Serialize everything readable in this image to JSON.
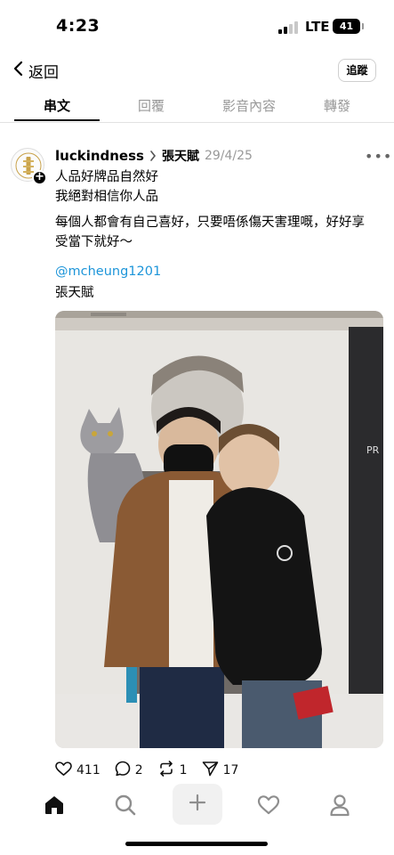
{
  "status_bar": {
    "time": "4:23",
    "network": "LTE",
    "battery": "41"
  },
  "header": {
    "back_label": "返回",
    "follow_label": "追蹤"
  },
  "tabs": [
    {
      "label": "串文",
      "active": true
    },
    {
      "label": "回覆",
      "active": false
    },
    {
      "label": "影音內容",
      "active": false
    },
    {
      "label": "轉發",
      "active": false
    }
  ],
  "post": {
    "author": "luckindness",
    "reply_to": "張天賦",
    "date": "29/4/25",
    "lines": [
      "人品好牌品自然好",
      "我絕對相信你人品",
      "每個人都會有自己喜好，只要唔係傷天害理嘅，好好享",
      "受當下就好～"
    ],
    "mention": "@mcheung1201",
    "tag_name": "張天賦"
  },
  "actions": {
    "likes": "411",
    "comments": "2",
    "reposts": "1",
    "shares": "17"
  },
  "bottom_nav": {
    "items": [
      "home-icon",
      "search-icon",
      "compose-icon",
      "activity-icon",
      "profile-icon"
    ]
  }
}
